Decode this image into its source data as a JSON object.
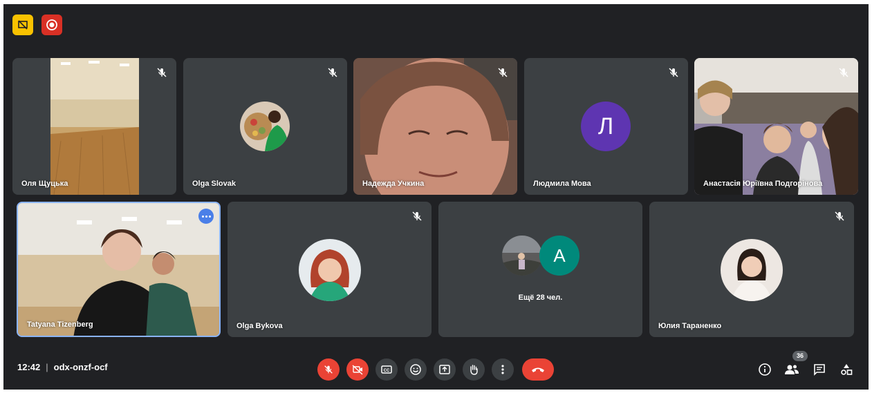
{
  "top_badges": [
    {
      "name": "presentation-icon",
      "color": "#f9c200"
    },
    {
      "name": "recording-icon",
      "color": "#d93025"
    }
  ],
  "participants": {
    "tile1": {
      "name": "Оля Щуцька",
      "mic_muted": true
    },
    "tile2": {
      "name": "Olga Slovak",
      "mic_muted": true
    },
    "tile3": {
      "name": "Надежда Учкина",
      "mic_muted": true
    },
    "tile4": {
      "name": "Людмила Мова",
      "avatar_letter": "Л",
      "avatar_color": "#5e35b1",
      "mic_muted": true
    },
    "tile5": {
      "name": "Анастасія Юріївна Подгорінова",
      "mic_muted": true
    },
    "tile6": {
      "name": "Tatyana Tizenberg",
      "pinned_highlight": true
    },
    "tile7": {
      "name": "Olga Bykova",
      "mic_muted": true
    },
    "tile8": {
      "more_label": "Ещё 28 чел.",
      "avatar_letter": "A",
      "avatar_color": "#00897b"
    },
    "tile9": {
      "name": "Юлия Тараненко",
      "mic_muted": true
    }
  },
  "bottom_bar": {
    "time": "12:42",
    "meeting_code": "odx-onzf-ocf",
    "people_count": "36",
    "controls": [
      "mic-off-icon",
      "camera-off-icon",
      "captions-icon",
      "emoji-icon",
      "present-icon",
      "raise-hand-icon",
      "more-options-icon",
      "leave-call-icon"
    ],
    "right_icons": [
      "info-icon",
      "people-icon",
      "chat-icon",
      "activities-icon"
    ]
  },
  "colors": {
    "background": "#202124",
    "tile": "#3c4043",
    "danger": "#ea4335",
    "accent": "#4a7fe8"
  }
}
